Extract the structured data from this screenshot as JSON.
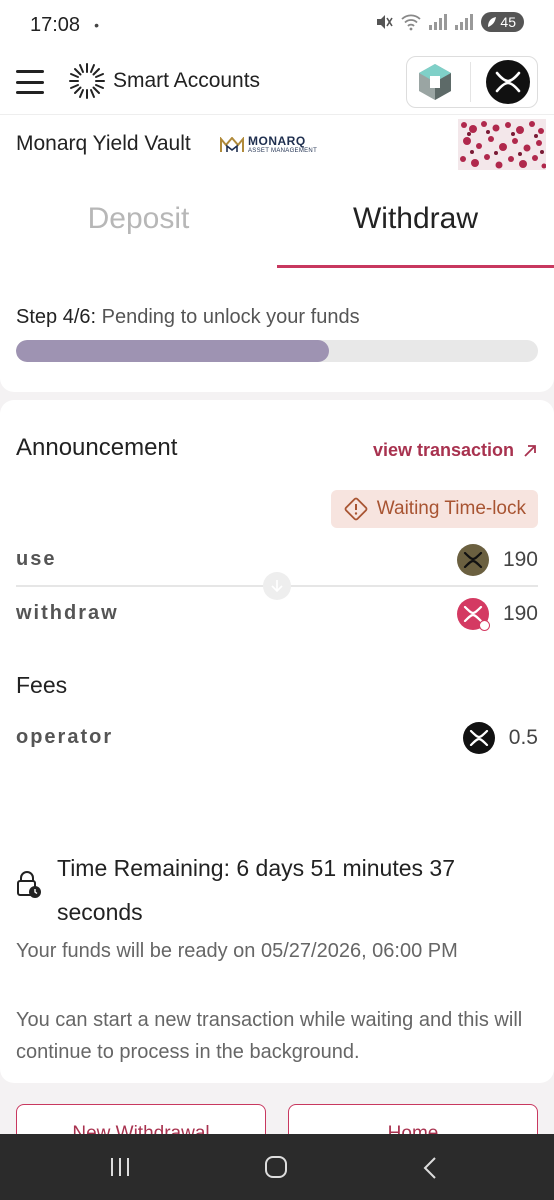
{
  "status_bar": {
    "time": "17:08",
    "dot": "•",
    "battery": "45"
  },
  "header": {
    "brand": "Smart Accounts"
  },
  "vault": {
    "name": "Monarq Yield Vault",
    "logo_text": "MONARQ",
    "logo_sub": "ASSET MANAGEMENT"
  },
  "tabs": {
    "deposit": "Deposit",
    "withdraw": "Withdraw",
    "active": "withdraw"
  },
  "step": {
    "label": "Step 4/6:",
    "description": "Pending to unlock your funds",
    "progress": 0.6
  },
  "announcement": {
    "title": "Announcement",
    "view_tx": "view transaction",
    "badge": "Waiting Time-lock",
    "rows": [
      {
        "label": "use",
        "value": "190",
        "icon": "xrp-coin-icon"
      },
      {
        "label": "withdraw",
        "value": "190",
        "icon": "xrp-vault-token-icon"
      }
    ]
  },
  "fees": {
    "title": "Fees",
    "rows": [
      {
        "label": "operator",
        "value": "0.5",
        "icon": "xrp-icon"
      }
    ]
  },
  "timer": {
    "text": "Time Remaining: 6 days 51 minutes 37 seconds",
    "ready": "Your funds will be ready on 05/27/2026, 06:00 PM",
    "background_note": "You can start a new transaction while waiting and this will continue to process in the background."
  },
  "buttons": {
    "new_withdrawal": "New Withdrawal",
    "home": "Home"
  },
  "colors": {
    "accent": "#c8385f",
    "progress": "#9e93b2",
    "badge_bg": "#f7e4df",
    "badge_text": "#a85432"
  }
}
